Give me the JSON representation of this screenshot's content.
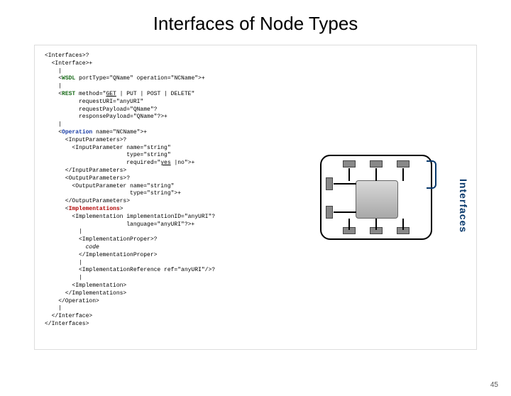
{
  "title": "Interfaces of Node Types",
  "page_number": "45",
  "diagram_label": "Interfaces",
  "code": {
    "l1": "<Interfaces>?",
    "l2": "  <Interface>+",
    "l3": "    |",
    "l4a": "    <",
    "l4_wsdl": "WSDL",
    "l4b": " portType=\"QName\" operation=\"NCName\">+",
    "l5": "    |",
    "l6a": "    <",
    "l6_rest": "REST",
    "l6b": " method=\"",
    "l6_get": "GET",
    "l6c": " | PUT | POST | DELETE\"",
    "l7": "          requestURI=\"anyURI\"",
    "l8": "          requestPayload=\"QName\"?",
    "l9": "          responsePayload=\"QName\"?>+",
    "l10": "    |",
    "l11a": "    <",
    "l11_op": "Operation",
    "l11b": " name=\"NCName\">+",
    "l12": "      <InputParameters>?",
    "l13": "        <InputParameter name=\"string\"",
    "l14": "                        type=\"string\"",
    "l15a": "                        required=\"",
    "l15_yes": "yes",
    "l15b": " |no\">+",
    "l16": "      </InputParameters>",
    "l17": "      <OutputParameters>?",
    "l18": "        <OutputParameter name=\"string\"",
    "l19": "                         type=\"string\">+",
    "l20": "      </OutputParameters>",
    "l21a": "      <",
    "l21_impl": "Implementations",
    "l21b": ">",
    "l22": "        <Implementation implementationID=\"anyURI\"?",
    "l23": "                        language=\"anyURI\"?>+",
    "l24": "          |",
    "l25": "          <ImplementationProper>?",
    "l26_code": "            code",
    "l27": "          </ImplementationProper>",
    "l28": "          |",
    "l29": "          <ImplementationReference ref=\"anyURI\"/>?",
    "l30": "          |",
    "l31": "        <Implementation>",
    "l32": "      </Implementations>",
    "l33": "    </Operation>",
    "l34": "    |",
    "l35": "  </Interface>",
    "l36": "</Interfaces>"
  }
}
